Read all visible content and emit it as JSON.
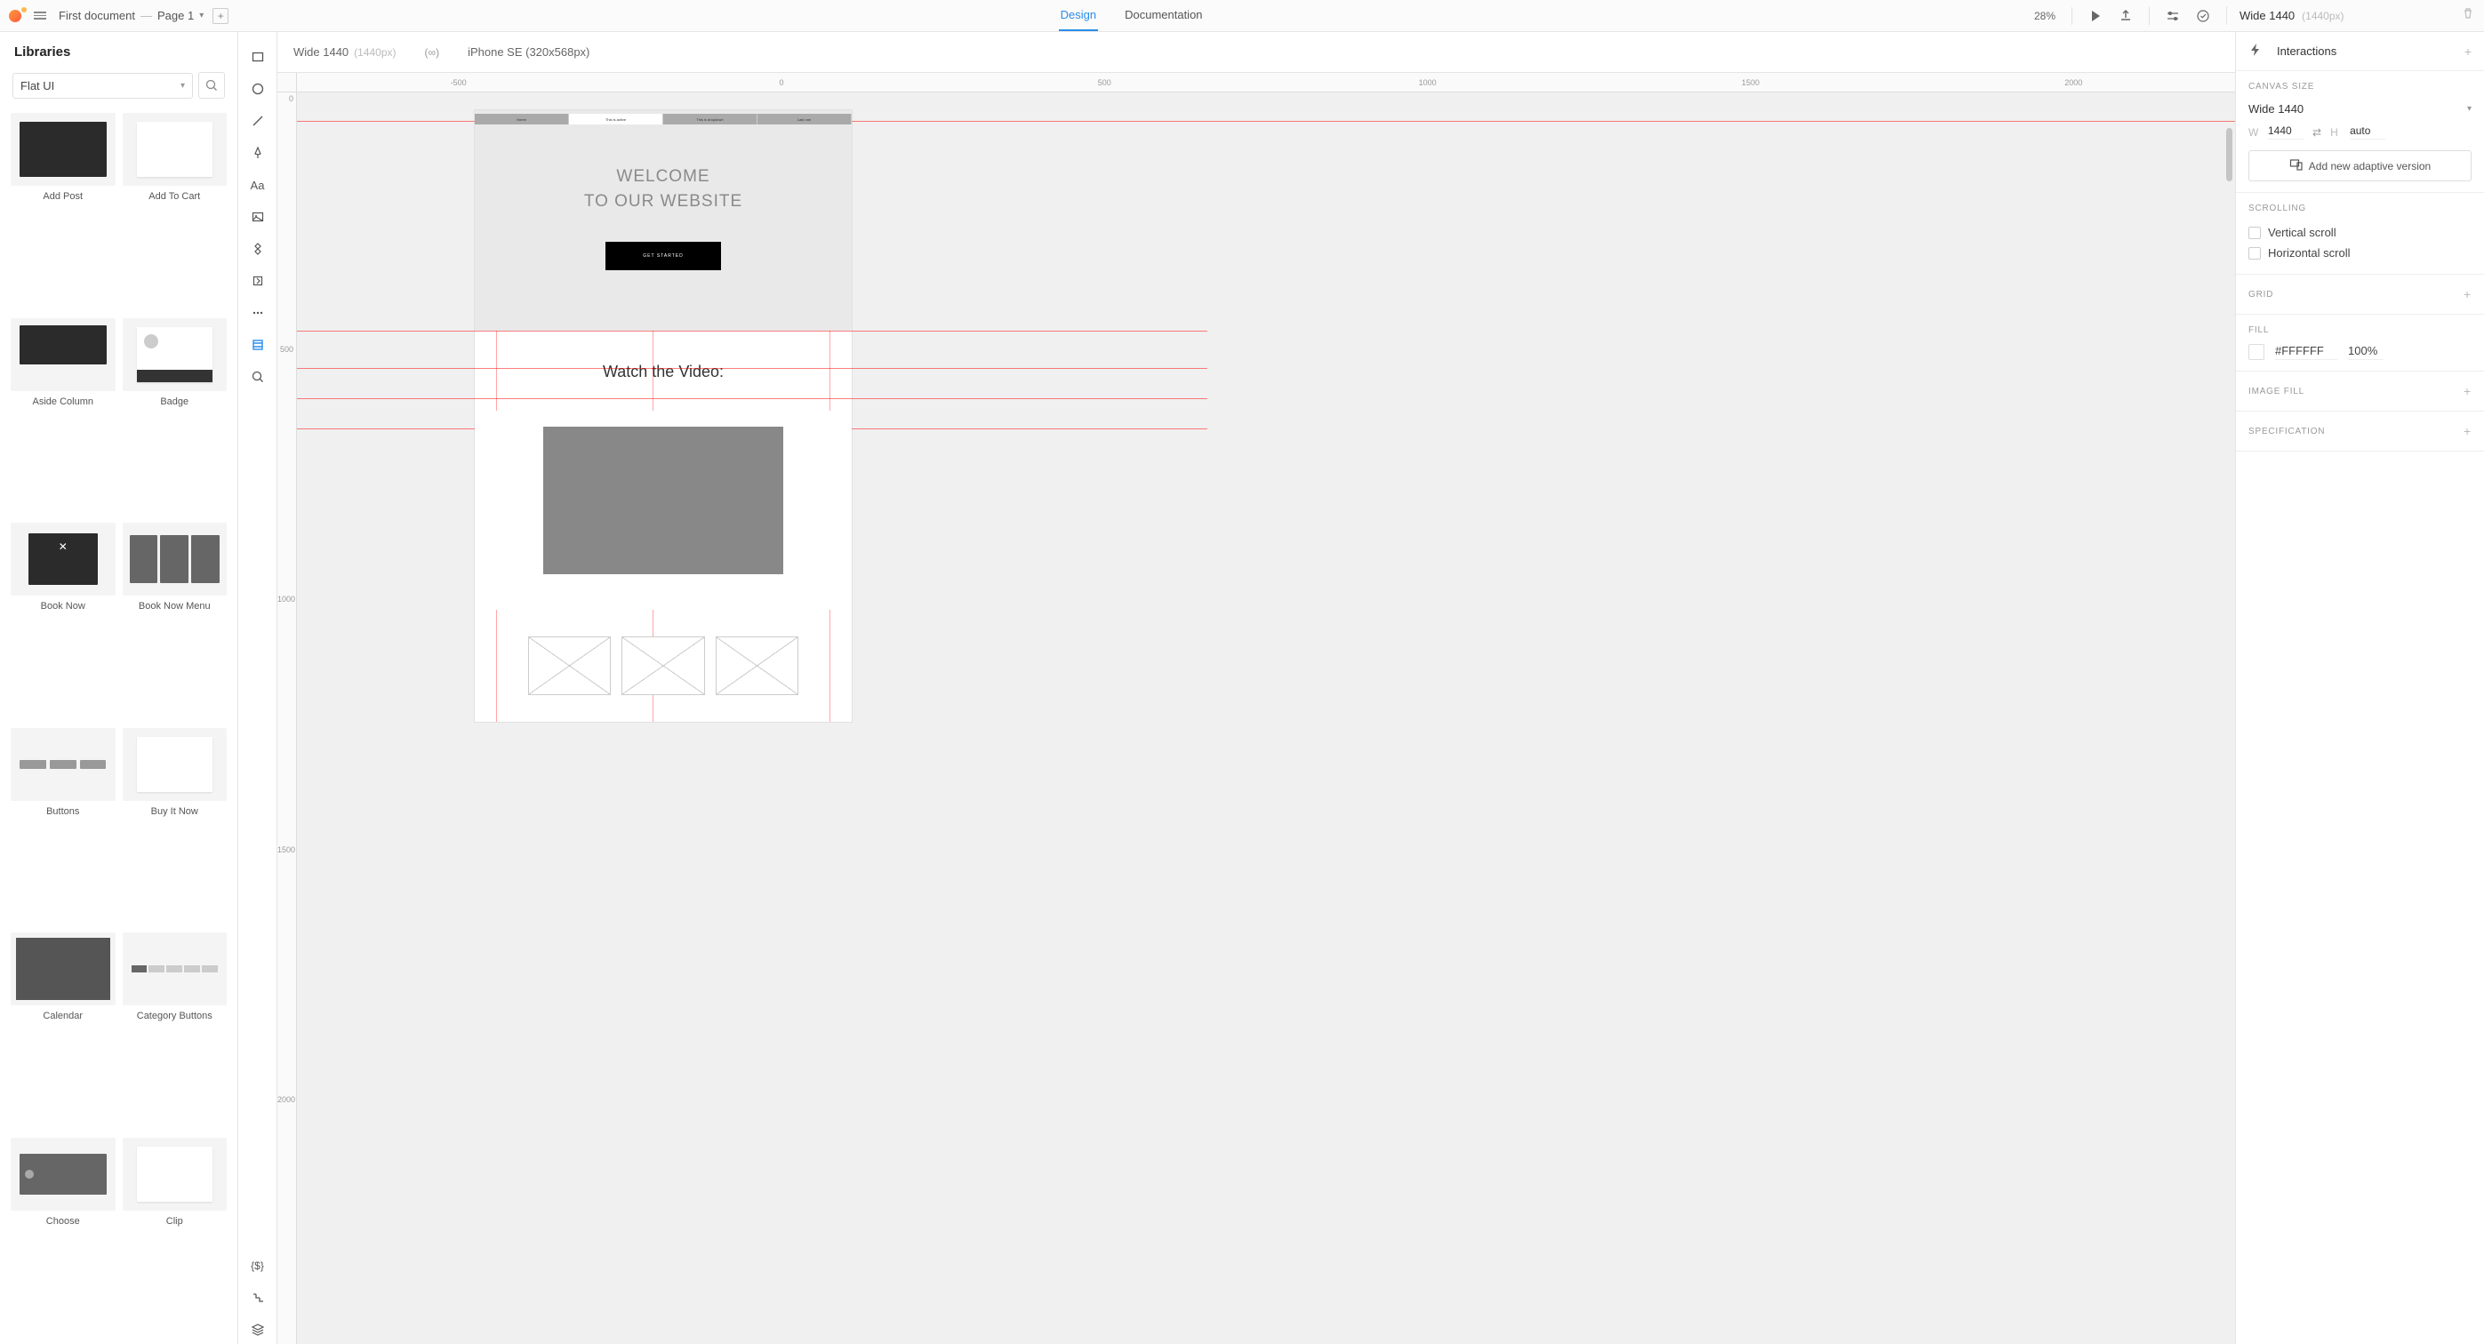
{
  "topbar": {
    "doc_name": "First document",
    "separator": "—",
    "page_name": "Page 1",
    "tabs": {
      "design": "Design",
      "documentation": "Documentation"
    },
    "zoom": "28%"
  },
  "inspector_header": {
    "name": "Wide 1440",
    "dim": "(1440px)"
  },
  "libraries": {
    "title": "Libraries",
    "selected": "Flat UI",
    "items": [
      "Add Post",
      "Add To Cart",
      "Aside Column",
      "Badge",
      "Book Now",
      "Book Now Menu",
      "Buttons",
      "Buy It Now",
      "Calendar",
      "Category Buttons",
      "Choose",
      "Clip"
    ]
  },
  "artboard_tabs": {
    "tab1_name": "Wide 1440",
    "tab1_dim": "(1440px)",
    "infinity": "(∞)",
    "tab2": "iPhone SE (320x568px)"
  },
  "ruler_x": [
    "-500",
    "0",
    "500",
    "1000",
    "1500",
    "2000"
  ],
  "ruler_y": [
    "0",
    "500",
    "1000",
    "1500",
    "2000"
  ],
  "artboard": {
    "nav": [
      "Home",
      "This is active",
      "This is dropdown",
      "Last one"
    ],
    "hero1": "WELCOME",
    "hero2": "TO OUR WEBSITE",
    "cta": "GET STARTED",
    "video_title": "Watch the Video:"
  },
  "inspector": {
    "interactions": "Interactions",
    "canvas_size_label": "CANVAS SIZE",
    "canvas_size_value": "Wide 1440",
    "w_label": "W",
    "w_value": "1440",
    "h_label": "H",
    "h_value": "auto",
    "adaptive_btn": "Add new adaptive version",
    "scroll_label": "SCROLLING",
    "vscroll": "Vertical scroll",
    "hscroll": "Horizontal scroll",
    "grid_label": "GRID",
    "fill_label": "FILL",
    "fill_hex": "#FFFFFF",
    "fill_pct": "100%",
    "image_fill": "IMAGE FILL",
    "specification": "SPECIFICATION"
  }
}
